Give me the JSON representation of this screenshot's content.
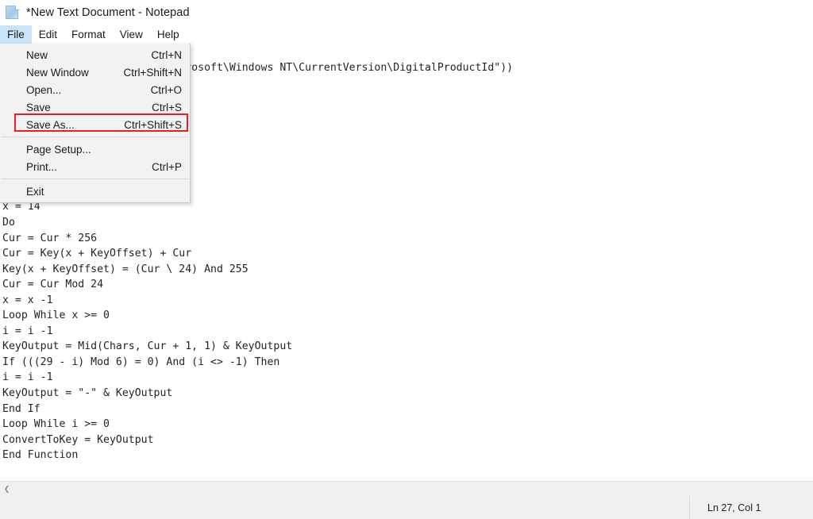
{
  "window": {
    "title": "*New Text Document - Notepad",
    "icon": "notepad-document-icon"
  },
  "menubar": {
    "items": [
      {
        "label": "File",
        "active": true
      },
      {
        "label": "Edit",
        "active": false
      },
      {
        "label": "Format",
        "active": false
      },
      {
        "label": "View",
        "active": false
      },
      {
        "label": "Help",
        "active": false
      }
    ]
  },
  "file_menu": {
    "open": true,
    "highlighted_item": "Save As...",
    "highlight_color": "#ee1c24",
    "items": [
      {
        "label": "New",
        "accel": "Ctrl+N"
      },
      {
        "label": "New Window",
        "accel": "Ctrl+Shift+N"
      },
      {
        "label": "Open...",
        "accel": "Ctrl+O"
      },
      {
        "label": "Save",
        "accel": "Ctrl+S"
      },
      {
        "label": "Save As...",
        "accel": "Ctrl+Shift+S"
      },
      {
        "label": "Page Setup...",
        "accel": ""
      },
      {
        "label": "Print...",
        "accel": "Ctrl+P"
      },
      {
        "label": "Exit",
        "accel": ""
      }
    ]
  },
  "editor": {
    "text": "t(\"WScript.Shell\")\nll.RegRead(\"HKLM\\SOFTWARE\\Microsoft\\Windows NT\\CurrentVersion\\DigitalProductId\"))\n\n\n\n\n2346789\"\n\n\n\nx = 14\nDo\nCur = Cur * 256\nCur = Key(x + KeyOffset) + Cur\nKey(x + KeyOffset) = (Cur \\ 24) And 255\nCur = Cur Mod 24\nx = x -1\nLoop While x >= 0\ni = i -1\nKeyOutput = Mid(Chars, Cur + 1, 1) & KeyOutput\nIf (((29 - i) Mod 6) = 0) And (i <> -1) Then\ni = i -1\nKeyOutput = \"-\" & KeyOutput\nEnd If\nLoop While i >= 0\nConvertToKey = KeyOutput\nEnd Function"
  },
  "scrollbar": {
    "left_arrow_icon": "chevron-left-icon"
  },
  "statusbar": {
    "position": "Ln 27, Col 1"
  }
}
